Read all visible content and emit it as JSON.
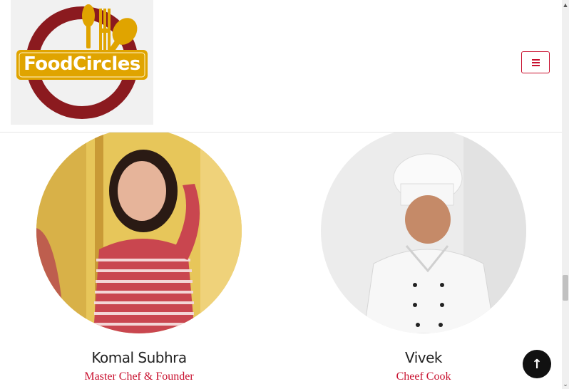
{
  "header": {
    "logo_text": "FoodCircles",
    "menu_icon": "hamburger-menu-icon"
  },
  "team": {
    "members": [
      {
        "name": "Komal Subhra",
        "role": "Master Chef & Founder"
      },
      {
        "name": "Vivek",
        "role": "Cheef Cook"
      }
    ]
  },
  "back_to_top": {
    "icon": "arrow-up-icon",
    "glyph": "↑"
  },
  "scrollbar": {
    "up_glyph": "▲",
    "down_glyph": "⌄"
  },
  "colors": {
    "accent": "#c8102e",
    "logo_ring": "#8b1a1f",
    "logo_gold": "#e0a400"
  }
}
